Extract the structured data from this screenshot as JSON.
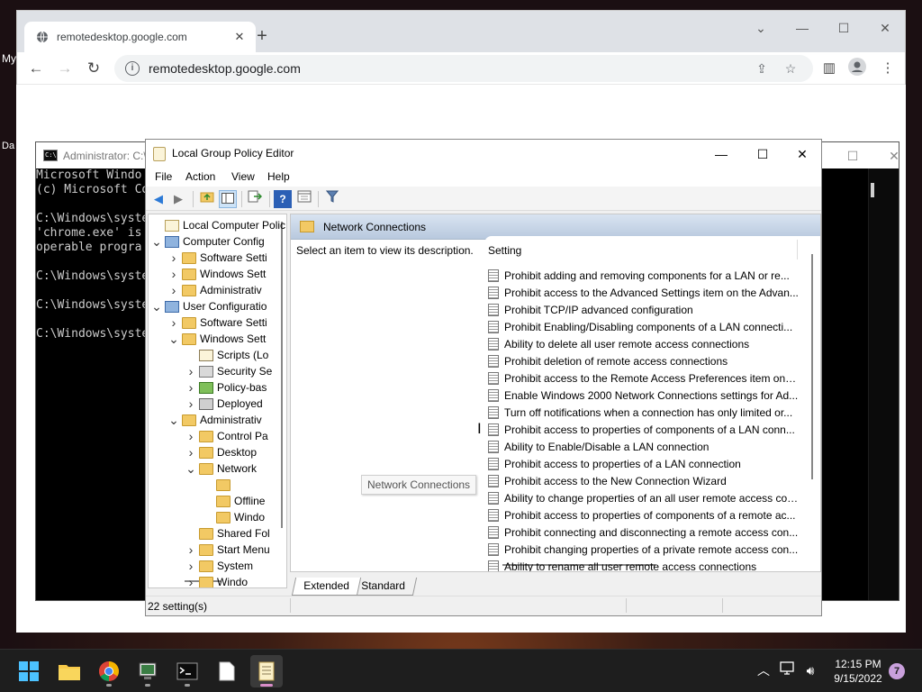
{
  "desktop": {
    "left_label_1": "My",
    "left_label_2": "Da"
  },
  "browser": {
    "tab_title": "remotedesktop.google.com",
    "new_tab": "+",
    "url": "remotedesktop.google.com"
  },
  "cmd": {
    "title": "Administrator: C:\\",
    "lines": [
      "Microsoft Windo",
      "(c) Microsoft Co",
      "",
      "C:\\Windows\\syste",
      "'chrome.exe' is",
      "operable progra",
      "",
      "C:\\Windows\\syste",
      "",
      "C:\\Windows\\syste",
      "",
      "C:\\Windows\\syste"
    ]
  },
  "gpe": {
    "title": "Local Group Policy Editor",
    "menu": [
      "File",
      "Action",
      "View",
      "Help"
    ],
    "tree": [
      {
        "label": "Local Computer Polic",
        "indent": 0,
        "expander": "",
        "icon": "policy"
      },
      {
        "label": "Computer Config",
        "indent": 0,
        "expander": "v",
        "icon": "computer"
      },
      {
        "label": "Software Setti",
        "indent": 1,
        "expander": ">",
        "icon": "folder"
      },
      {
        "label": "Windows Sett",
        "indent": 1,
        "expander": ">",
        "icon": "folder"
      },
      {
        "label": "Administrativ",
        "indent": 1,
        "expander": ">",
        "icon": "folder"
      },
      {
        "label": "User Configuratio",
        "indent": 0,
        "expander": "v",
        "icon": "user"
      },
      {
        "label": "Software Setti",
        "indent": 1,
        "expander": ">",
        "icon": "folder"
      },
      {
        "label": "Windows Sett",
        "indent": 1,
        "expander": "v",
        "icon": "folder"
      },
      {
        "label": "Scripts (Lo",
        "indent": 2,
        "expander": "",
        "icon": "script"
      },
      {
        "label": "Security Se",
        "indent": 2,
        "expander": ">",
        "icon": "security"
      },
      {
        "label": "Policy-bas",
        "indent": 2,
        "expander": ">",
        "icon": "chart"
      },
      {
        "label": "Deployed",
        "indent": 2,
        "expander": ">",
        "icon": "printer"
      },
      {
        "label": "Administrativ",
        "indent": 1,
        "expander": "v",
        "icon": "folder"
      },
      {
        "label": "Control Pa",
        "indent": 2,
        "expander": ">",
        "icon": "folder"
      },
      {
        "label": "Desktop",
        "indent": 2,
        "expander": ">",
        "icon": "folder"
      },
      {
        "label": "Network",
        "indent": 2,
        "expander": "v",
        "icon": "folder"
      },
      {
        "label": "",
        "indent": 3,
        "expander": "",
        "icon": "folder"
      },
      {
        "label": "Offline",
        "indent": 3,
        "expander": "",
        "icon": "folder"
      },
      {
        "label": "Windo",
        "indent": 3,
        "expander": "",
        "icon": "folder"
      },
      {
        "label": "Shared Fol",
        "indent": 2,
        "expander": "",
        "icon": "folder"
      },
      {
        "label": "Start Menu",
        "indent": 2,
        "expander": ">",
        "icon": "folder"
      },
      {
        "label": "System",
        "indent": 2,
        "expander": ">",
        "icon": "folder"
      },
      {
        "label": "Windo",
        "indent": 2,
        "expander": ">",
        "icon": "folder"
      }
    ],
    "tooltip": "Network Connections",
    "header": "Network Connections",
    "description": "Select an item to view its description.",
    "column_setting": "Setting",
    "settings": [
      "Prohibit adding and removing components for a LAN or re...",
      "Prohibit access to the Advanced Settings item on the Advan...",
      "Prohibit TCP/IP advanced configuration",
      "Prohibit Enabling/Disabling components of a LAN connecti...",
      "Ability to delete all user remote access connections",
      "Prohibit deletion of remote access connections",
      "Prohibit access to the Remote Access Preferences item on t...",
      "Enable Windows 2000 Network Connections settings for Ad...",
      "Turn off notifications when a connection has only limited or...",
      "Prohibit access to properties of components of a LAN conn...",
      "Ability to Enable/Disable a LAN connection",
      "Prohibit access to properties of a LAN connection",
      "Prohibit access to the New Connection Wizard",
      "Ability to change properties of an all user remote access con...",
      "Prohibit access to properties of components of a remote ac...",
      "Prohibit connecting and disconnecting a remote access con...",
      "Prohibit changing properties of a private remote access con...",
      "Ability to rename all user remote access connections"
    ],
    "tabs": [
      "Extended",
      "Standard"
    ],
    "status": "22 setting(s)"
  },
  "taskbar": {
    "time": "12:15 PM",
    "date": "9/15/2022",
    "notification_count": "7"
  }
}
